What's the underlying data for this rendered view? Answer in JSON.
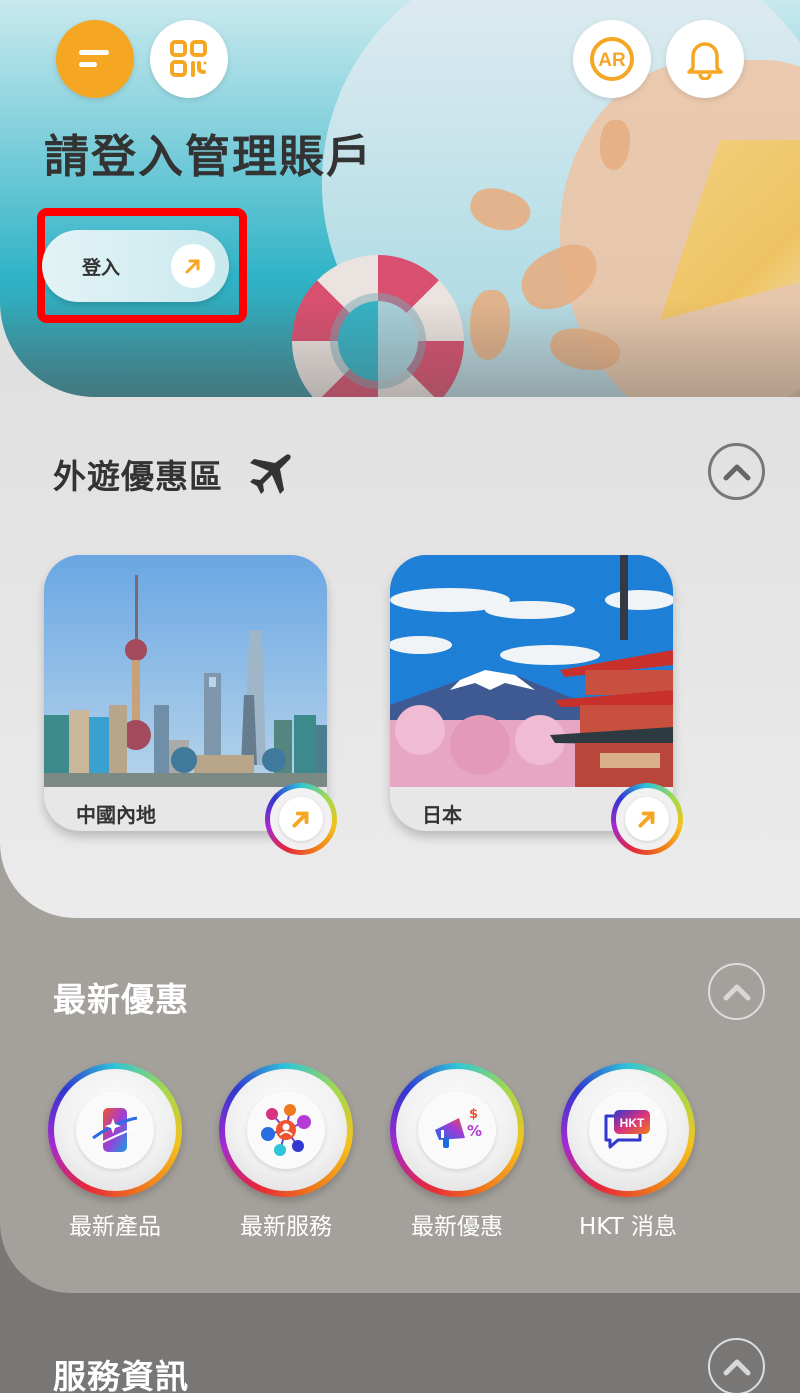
{
  "header": {
    "menu_icon": "menu-icon",
    "qr_icon": "qr-code-icon",
    "ar_label": "AR",
    "bell_icon": "bell-icon",
    "title": "請登入管理賬戶",
    "login_label": "登入",
    "login_icon": "arrow-up-right-icon"
  },
  "travel": {
    "title": "外遊優惠區",
    "title_icon": "airplane-icon",
    "collapse_icon": "chevron-up-icon",
    "destinations": [
      {
        "label": "中國內地",
        "image": "shanghai-skyline",
        "icon": "arrow-up-right-icon"
      },
      {
        "label": "日本",
        "image": "mount-fuji-pagoda",
        "icon": "arrow-up-right-icon"
      }
    ]
  },
  "latest": {
    "title": "最新優惠",
    "collapse_icon": "chevron-up-icon",
    "tiles": [
      {
        "label": "最新產品",
        "icon": "new-product-phone-icon"
      },
      {
        "label": "最新服務",
        "icon": "services-network-icon"
      },
      {
        "label": "最新優惠",
        "icon": "megaphone-discount-icon"
      },
      {
        "label": "HKT 消息",
        "icon": "hkt-message-icon"
      }
    ]
  },
  "services": {
    "title": "服務資訊",
    "collapse_icon": "chevron-up-icon"
  },
  "colors": {
    "accent": "#f5a623",
    "highlight": "#ff0000",
    "text_dark": "#333333",
    "latest_bg": "#a4a09c",
    "services_bg": "#797775"
  }
}
